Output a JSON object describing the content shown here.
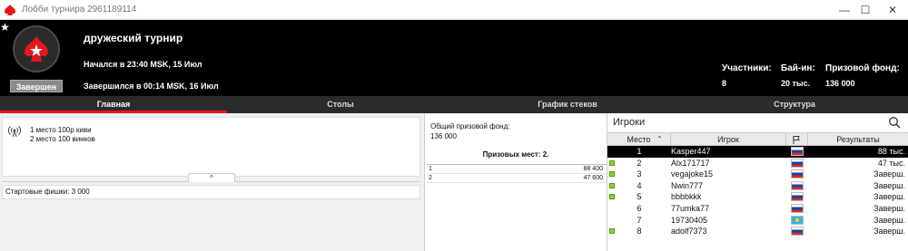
{
  "window": {
    "title": "Лобби турнира 2961189114",
    "minimize": "—",
    "maximize": "☐",
    "close": "✕"
  },
  "header": {
    "status": "Завершен",
    "name": "дружеский турнир",
    "started": "Начался в 23:40 MSK, 15 Июл",
    "ended": "Завершился в 00:14 MSK, 16 Июл",
    "stats": [
      {
        "label": "Участники:",
        "value": "8"
      },
      {
        "label": "Бай-ин:",
        "value": "20 тыс."
      },
      {
        "label": "Призовой фонд:",
        "value": "136 000"
      }
    ]
  },
  "tabs": [
    {
      "label": "Главная",
      "active": true
    },
    {
      "label": "Столы",
      "active": false
    },
    {
      "label": "График стеков",
      "active": false
    },
    {
      "label": "Структура",
      "active": false
    }
  ],
  "main": {
    "notes": [
      "1 место 100р киви",
      "2 место 100 винков"
    ],
    "collapse": "^",
    "chips": "Стартовые фишки:  3 000"
  },
  "prize": {
    "pool_label": "Общий призовой фонд:",
    "pool_value": "136 000",
    "paid_places": "Призовых мест: 2.",
    "rows": [
      {
        "place": "1",
        "amount": "88 400"
      },
      {
        "place": "2",
        "amount": "47 600"
      }
    ]
  },
  "players": {
    "title": "Игроки",
    "columns": {
      "place": "Место",
      "player": "Игрок",
      "results": "Результаты"
    },
    "rows": [
      {
        "place": "1",
        "name": "Kasper447",
        "flag": "ru",
        "result": "88 тыс.",
        "online": false,
        "selected": true
      },
      {
        "place": "2",
        "name": "Alx171717",
        "flag": "ru",
        "result": "47 тыс.",
        "online": true,
        "selected": false
      },
      {
        "place": "3",
        "name": "vegajoke15",
        "flag": "ru",
        "result": "Заверш.",
        "online": true,
        "selected": false
      },
      {
        "place": "4",
        "name": "Nwin777",
        "flag": "ru",
        "result": "Заверш.",
        "online": true,
        "selected": false
      },
      {
        "place": "5",
        "name": "bbbbkkk",
        "flag": "ru",
        "result": "Заверш.",
        "online": true,
        "selected": false
      },
      {
        "place": "6",
        "name": "77umka77",
        "flag": "ru",
        "result": "Заверш.",
        "online": false,
        "selected": false
      },
      {
        "place": "7",
        "name": "19730405",
        "flag": "kz",
        "result": "Заверш.",
        "online": false,
        "selected": false
      },
      {
        "place": "8",
        "name": "adolf7373",
        "flag": "ru",
        "result": "Заверш.",
        "online": true,
        "selected": false
      }
    ]
  },
  "colors": {
    "accent": "#e5171d",
    "online": "#8bd12f",
    "header_bg": "#000000"
  }
}
